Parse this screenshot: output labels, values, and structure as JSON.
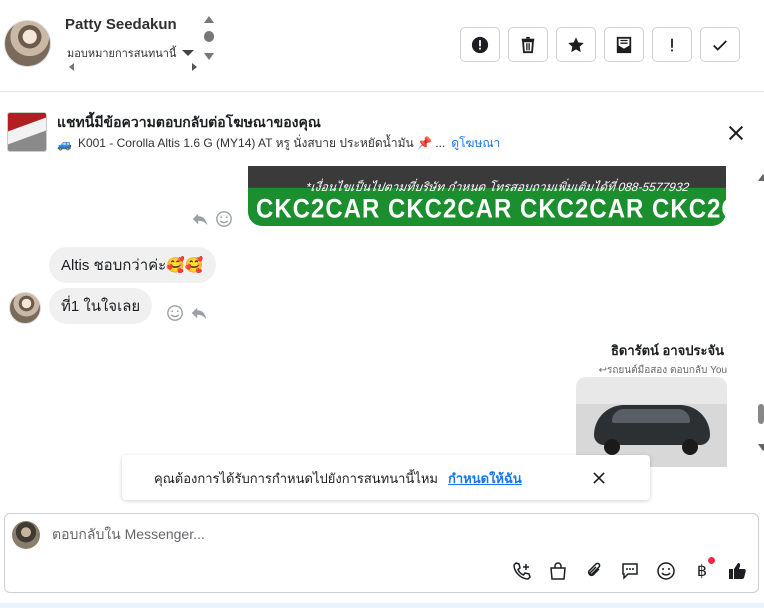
{
  "header": {
    "contact_name": "Patty Seedakun",
    "assign_label": "มอบหมายการสนทนานี้"
  },
  "toolbar": {
    "actions": [
      "report",
      "delete",
      "star",
      "archive",
      "important",
      "done"
    ]
  },
  "ad_banner": {
    "title": "แชทนี้มีข้อความตอบกลับต่อโฆษณาของคุณ",
    "subtitle": "K001 - Corolla Altis 1.6 G (MY14) AT หรู นั่งสบาย ประหยัดน้ำมัน 📌 ...",
    "link_label": "ดูโฆษณา"
  },
  "conversation": {
    "image_caption": "*เงื่อนไขเป็นไปตามที่บริษัท กำหนด โทรสอบถามเพิ่มเติมได้ที่ 088-5577932",
    "image_brand": "CKC2CAR CKC2CAR CKC2CAR CKC2CAR CKC2CAR CKC2",
    "messages": [
      {
        "text": "Altis ชอบกว่าค่ะ🥰🥰"
      },
      {
        "text": "ที่1 ในใจเลย"
      }
    ],
    "outgoing_sender": "ธิดารัตน์ อาจประจัน",
    "reply_note": "รถยนต์มือสอง ตอบกลับ You"
  },
  "notification": {
    "text": "คุณต้องการได้รับการกำหนดไปยังการสนทนานี้ไหม",
    "link_label": "กำหนดให้ฉัน"
  },
  "composer": {
    "placeholder": "ตอบกลับใน Messenger...",
    "currency_symbol": "฿"
  }
}
